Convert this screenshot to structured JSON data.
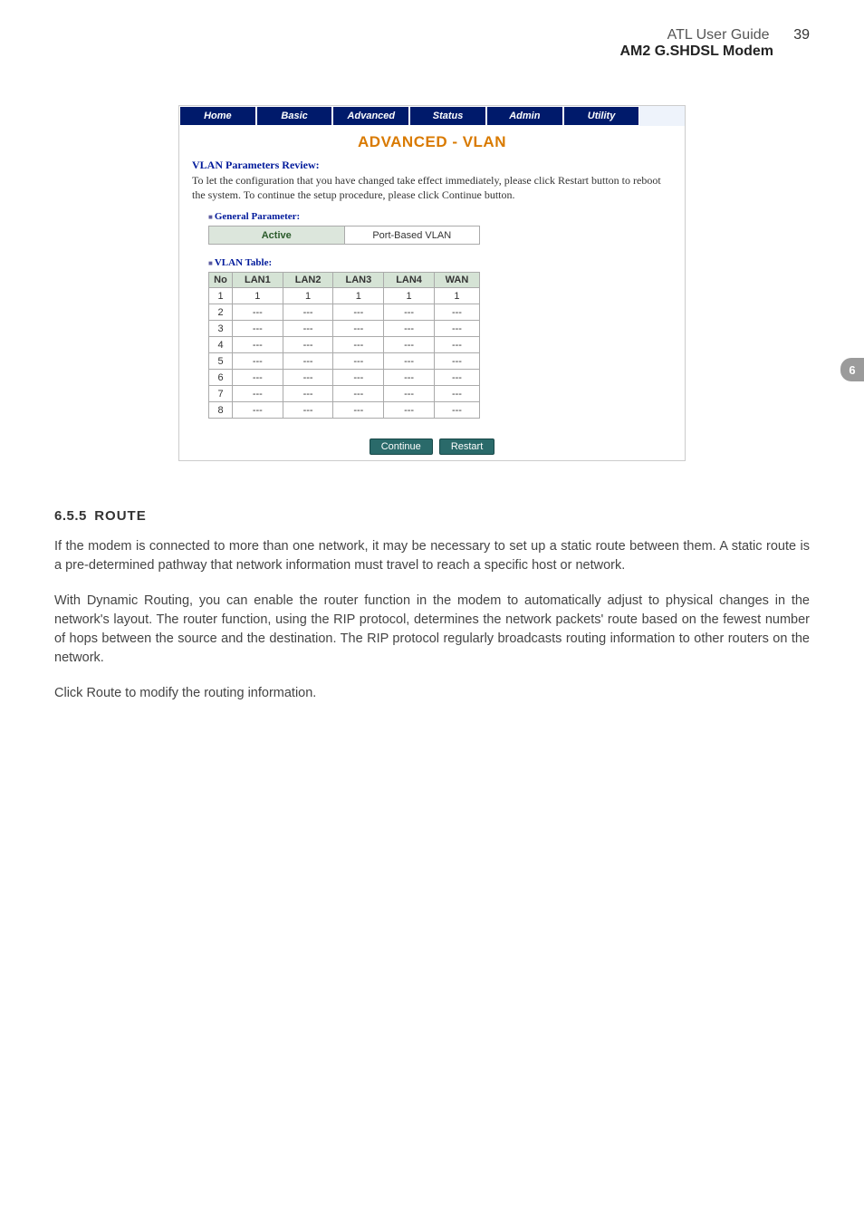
{
  "header": {
    "title": "ATL User Guide",
    "page_number": "39",
    "subtitle": "AM2 G.SHDSL Modem"
  },
  "chapter_tab": "6",
  "screenshot": {
    "nav": [
      "Home",
      "Basic",
      "Advanced",
      "Status",
      "Admin",
      "Utility"
    ],
    "title": "ADVANCED - VLAN",
    "review_heading": "VLAN Parameters Review:",
    "review_text": "To let the configuration that you have changed take effect immediately,  please click Restart button to reboot the system.  To continue the setup procedure, please click Continue button.",
    "general_param_label": "General Parameter:",
    "param_left": "Active",
    "param_right": "Port-Based VLAN",
    "vlan_table_label": "VLAN Table:",
    "vlan_headers": [
      "No",
      "LAN1",
      "LAN2",
      "LAN3",
      "LAN4",
      "WAN"
    ],
    "vlan_rows": [
      [
        "1",
        "1",
        "1",
        "1",
        "1",
        "1"
      ],
      [
        "2",
        "---",
        "---",
        "---",
        "---",
        "---"
      ],
      [
        "3",
        "---",
        "---",
        "---",
        "---",
        "---"
      ],
      [
        "4",
        "---",
        "---",
        "---",
        "---",
        "---"
      ],
      [
        "5",
        "---",
        "---",
        "---",
        "---",
        "---"
      ],
      [
        "6",
        "---",
        "---",
        "---",
        "---",
        "---"
      ],
      [
        "7",
        "---",
        "---",
        "---",
        "---",
        "---"
      ],
      [
        "8",
        "---",
        "---",
        "---",
        "---",
        "---"
      ]
    ],
    "btn_continue": "Continue",
    "btn_restart": "Restart"
  },
  "section": {
    "number": "6.5.5",
    "title": "ROUTE",
    "p1": "If the modem is connected to more than one network, it may be necessary to set up a static route between them. A static route is a pre-determined pathway that network information must travel to reach a specific host or network.",
    "p2": "With Dynamic Routing, you can enable the router function in the modem to automatically adjust to physical changes in the network's layout. The router function, using the RIP protocol, determines the network packets' route based on the fewest number of hops between the source and the destination. The RIP protocol regularly broadcasts routing information to other routers on the network.",
    "p3": "Click Route to modify the routing information."
  }
}
